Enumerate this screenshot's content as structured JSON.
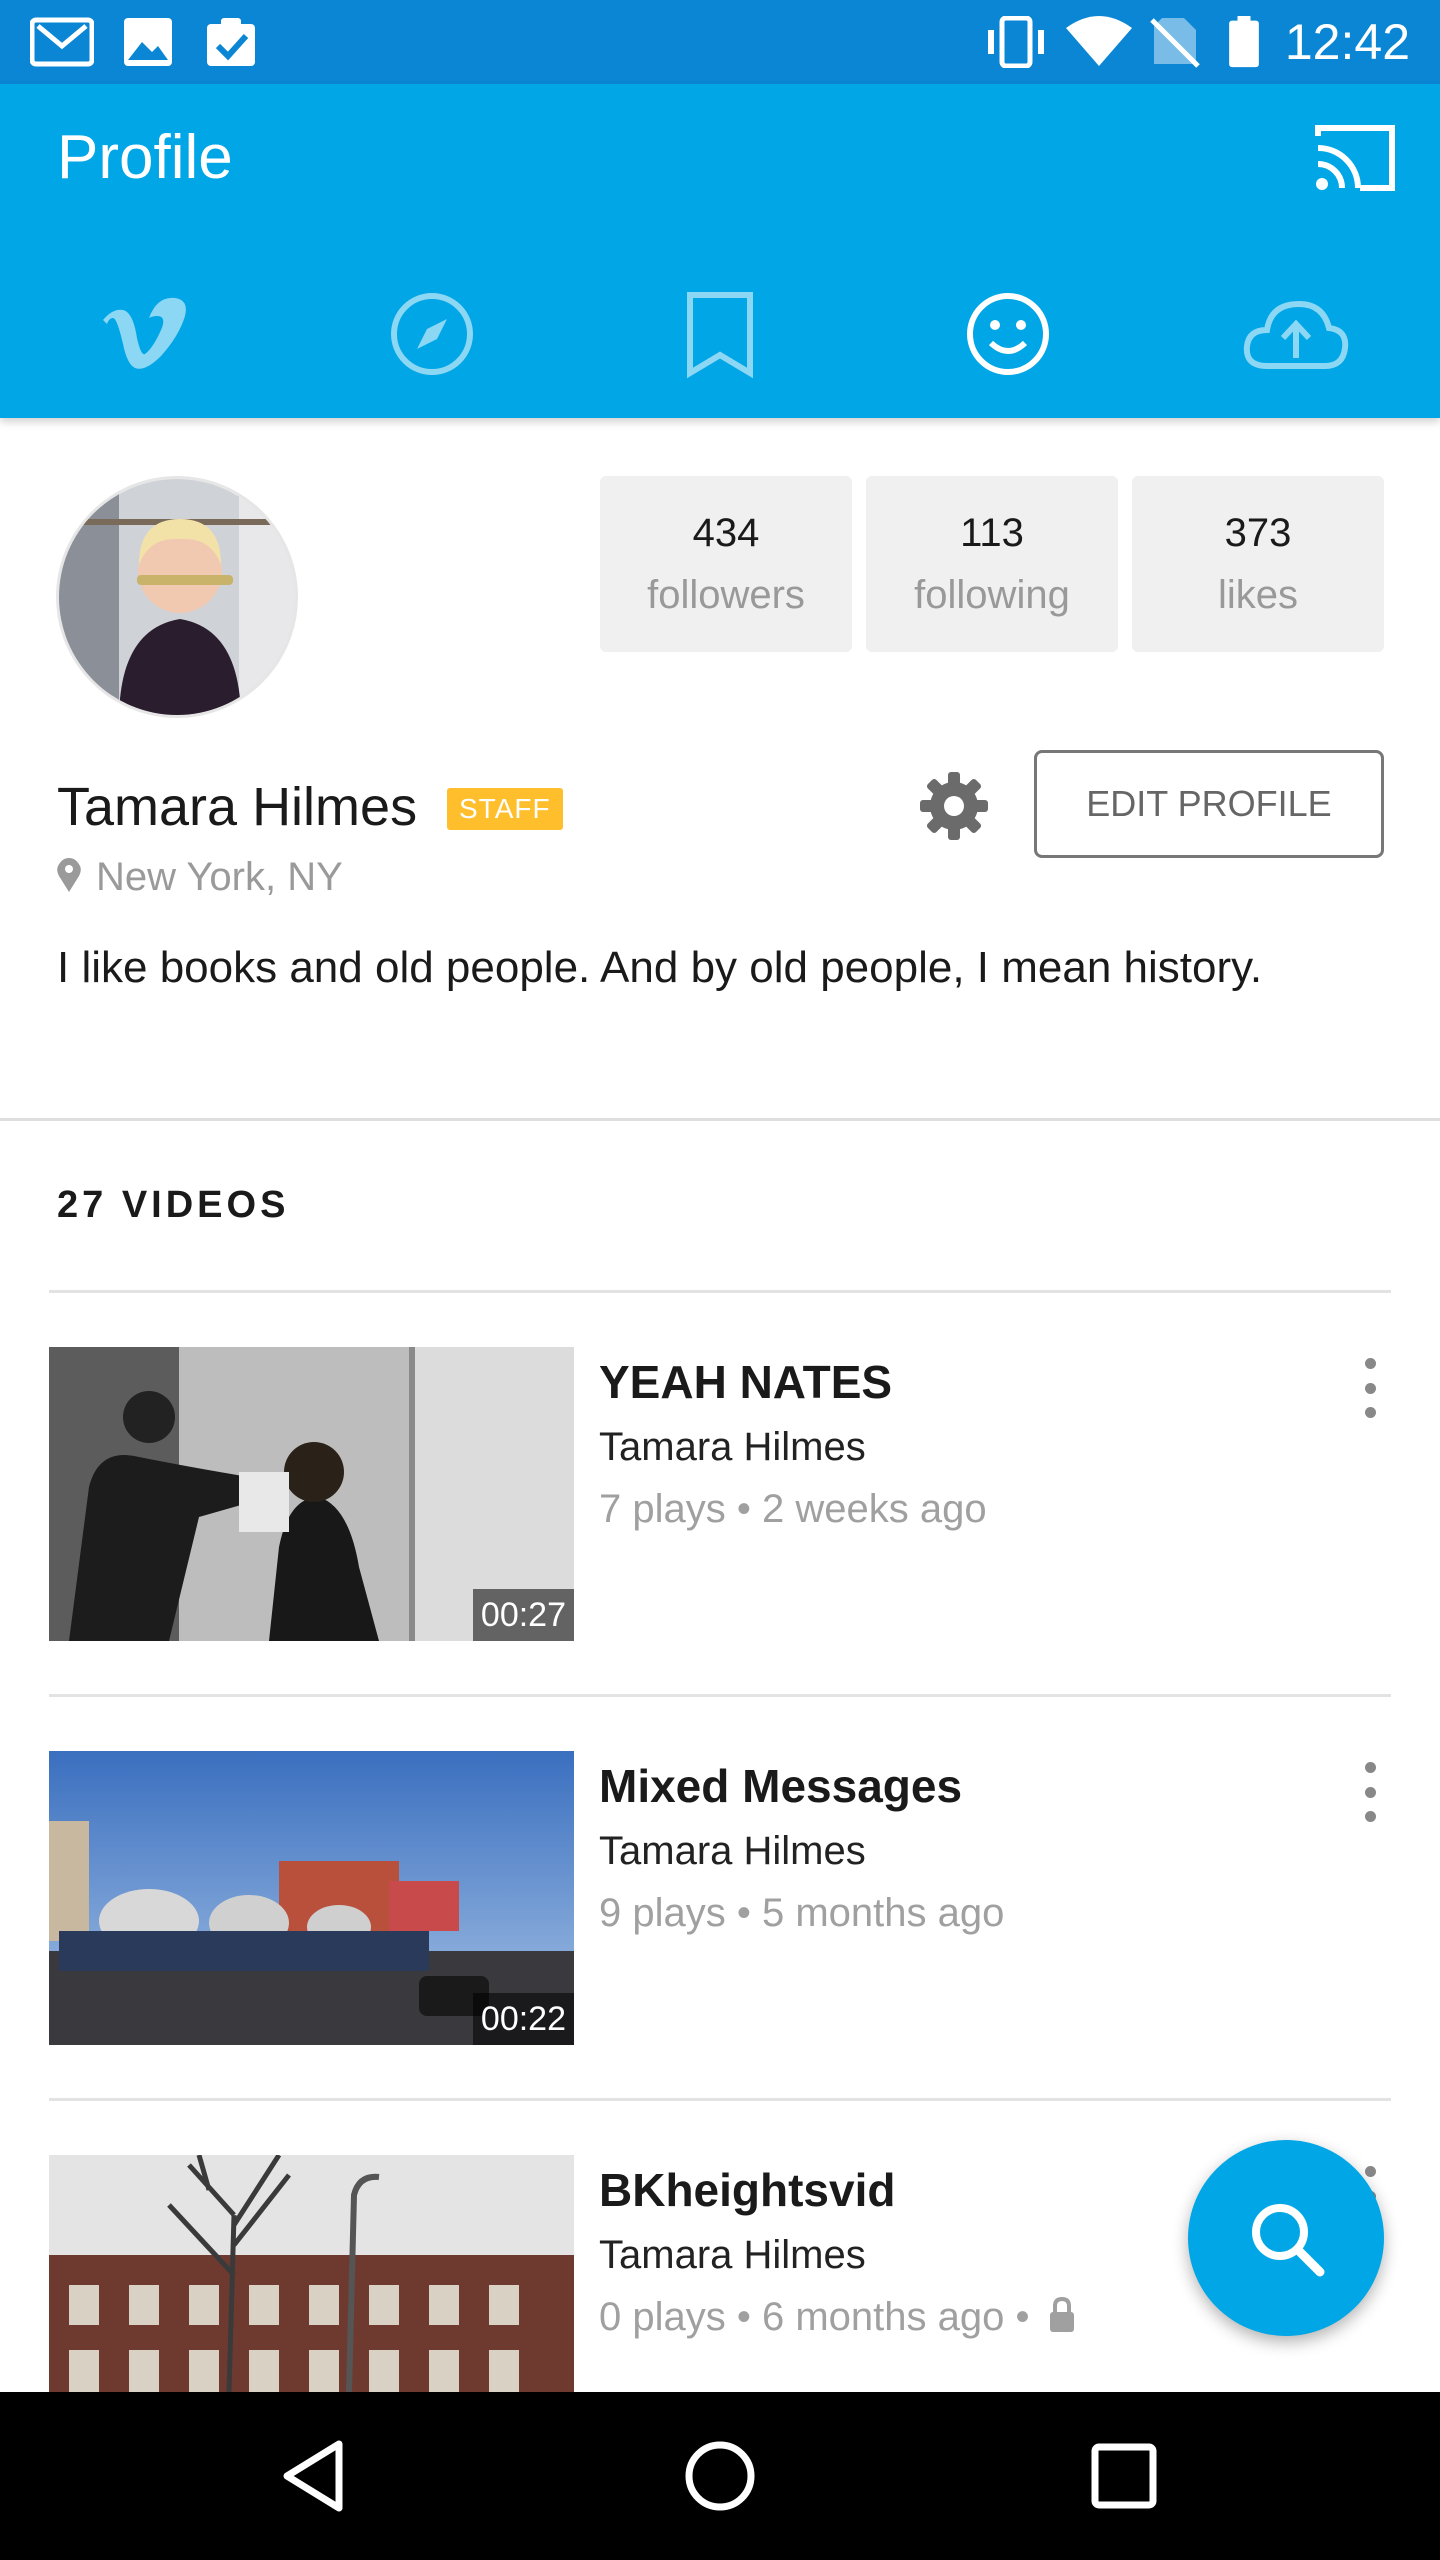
{
  "status_bar": {
    "time": "12:42",
    "left_icons": [
      "gmail-icon",
      "image-icon",
      "clipboard-check-icon"
    ],
    "right_icons": [
      "vibrate-icon",
      "wifi-icon",
      "no-sim-icon",
      "battery-icon"
    ]
  },
  "app_bar": {
    "title": "Profile",
    "cast_icon": "cast-icon",
    "tabs": [
      {
        "name": "vimeo-home",
        "icon": "vimeo-icon",
        "active": false
      },
      {
        "name": "explore",
        "icon": "compass-icon",
        "active": false
      },
      {
        "name": "watch-later",
        "icon": "bookmark-icon",
        "active": false
      },
      {
        "name": "profile",
        "icon": "smiley-icon",
        "active": true
      },
      {
        "name": "upload",
        "icon": "cloud-upload-icon",
        "active": false
      }
    ]
  },
  "profile": {
    "name": "Tamara Hilmes",
    "badge": "STAFF",
    "location": "New York, NY",
    "bio": "I like books and old people. And by old people, I mean history.",
    "edit_button": "EDIT PROFILE",
    "stats": [
      {
        "value": "434",
        "label": "followers"
      },
      {
        "value": "113",
        "label": "following"
      },
      {
        "value": "373",
        "label": "likes"
      }
    ]
  },
  "videos": {
    "header": "27 VIDEOS",
    "items": [
      {
        "title": "YEAH NATES",
        "author": "Tamara Hilmes",
        "meta": "7 plays • 2 weeks ago",
        "duration": "00:27",
        "private": false
      },
      {
        "title": "Mixed Messages",
        "author": "Tamara Hilmes",
        "meta": "9 plays • 5 months ago",
        "duration": "00:22",
        "private": false
      },
      {
        "title": "BKheightsvid",
        "author": "Tamara Hilmes",
        "meta": "0 plays • 6 months ago •",
        "duration": "",
        "private": true
      }
    ]
  },
  "colors": {
    "accent": "#00a6e6",
    "status_bar": "#0b86d4",
    "badge": "#ffbe2b"
  },
  "fab": {
    "icon": "search-icon"
  },
  "nav_bar": {
    "icons": [
      "back-icon",
      "home-icon",
      "recents-icon"
    ]
  }
}
